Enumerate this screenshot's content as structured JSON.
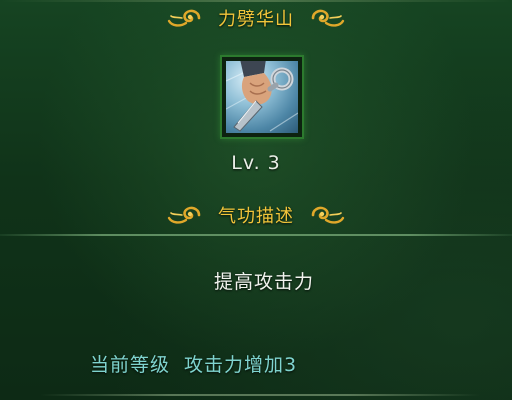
{
  "skill": {
    "name": "力劈华山",
    "icon": "skill-fist-icon",
    "level": "Lv. 3"
  },
  "description_header": "气功描述",
  "description": "提高攻击力",
  "current": {
    "label": "当前等级",
    "effect": "攻击力增加3"
  },
  "colors": {
    "title": "#f2c53a",
    "current_text": "#7fd4cf",
    "frame": "#2c7a2e",
    "background": "#123a1c"
  }
}
